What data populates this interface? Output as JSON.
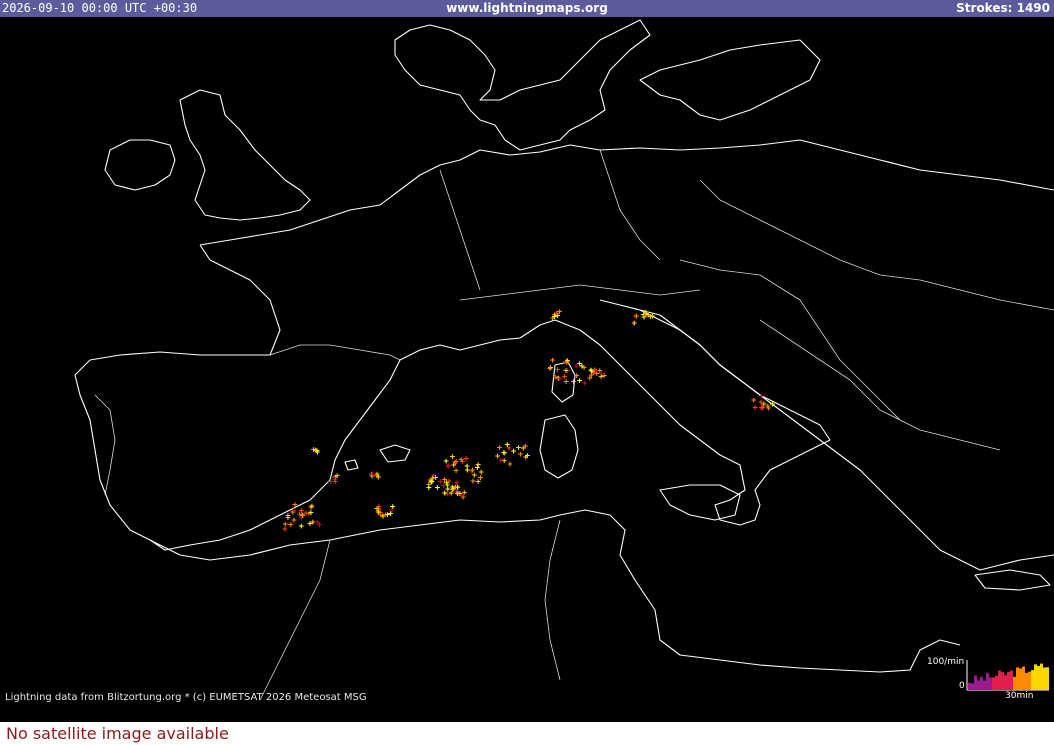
{
  "header": {
    "datetime": "2026-09-10 00:00 UTC +00:30",
    "site": "www.lightningmaps.org",
    "strokes_label": "Strokes: 1490"
  },
  "footer": {
    "credit": "Lightning data from Blitzortung.org  *  (c) EUMETSAT 2026 Meteosat MSG",
    "no_satellite": "No satellite image available"
  },
  "legend": {
    "max_label": "100/min",
    "min_label": "0",
    "time_label": "30min"
  },
  "colors": {
    "header_bg": "#5c5c9c",
    "map_bg": "#000000",
    "coast": "#ffffff",
    "strike_new": "#ffff00",
    "strike_mid": "#ff8c00",
    "strike_old": "#c8002a",
    "no_sat_text": "#8b1a1a"
  }
}
